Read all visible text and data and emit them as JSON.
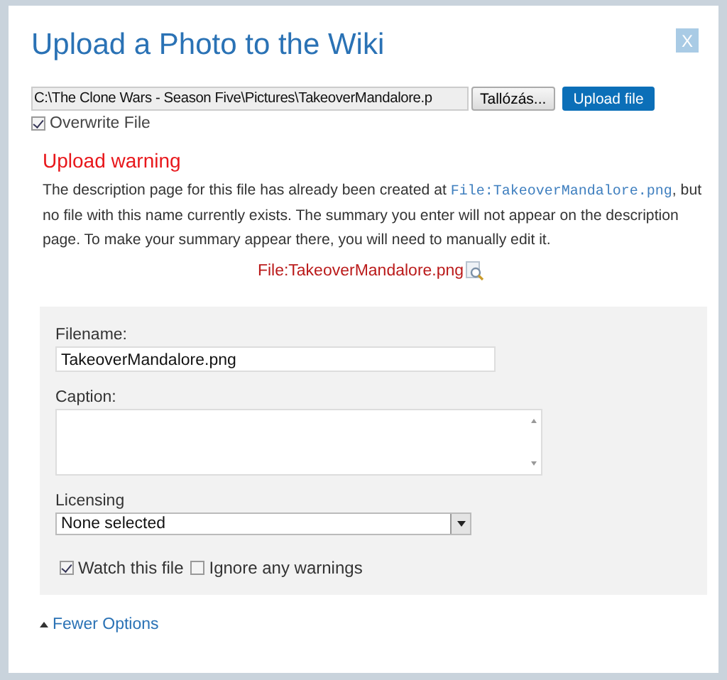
{
  "dialog": {
    "title": "Upload a Photo to the Wiki",
    "close": "X"
  },
  "upload": {
    "file_path": "C:\\The Clone Wars - Season Five\\Pictures\\TakeoverMandalore.p",
    "browse_button": "Tallózás...",
    "upload_button": "Upload file",
    "overwrite": {
      "label": "Overwrite File",
      "checked": true
    }
  },
  "warning": {
    "heading": "Upload warning",
    "text_before": "The description page for this file has already been created at ",
    "link": "File:TakeoverMandalore.png",
    "text_after": ", but no file with this name currently exists. The summary you enter will not appear on the description page. To make your summary appear there, you will need to manually edit it.",
    "file_link": "File:TakeoverMandalore.png"
  },
  "form": {
    "filename_label": "Filename:",
    "filename": "TakeoverMandalore.png",
    "caption_label": "Caption:",
    "licensing_label": "Licensing",
    "licensing": "None selected",
    "options": [
      {
        "label": "Watch this file",
        "checked": true
      },
      {
        "label": "Ignore any warnings",
        "checked": false
      }
    ]
  },
  "fewer_options": "Fewer Options"
}
